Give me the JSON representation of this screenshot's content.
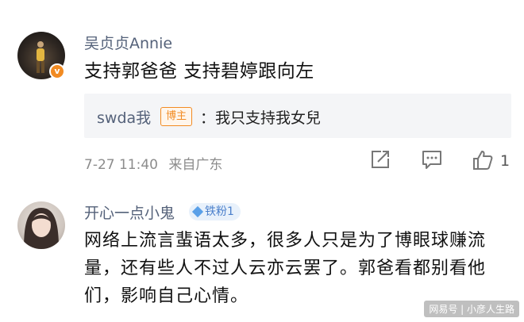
{
  "comments": [
    {
      "username": "吴贞贞Annie",
      "text": "支持郭爸爸 支持碧婷跟向左",
      "verified_badge": "v",
      "reply": {
        "username": "swda我",
        "tag": "博主",
        "text": "：我只支持我女兒"
      },
      "timestamp": "7-27 11:40",
      "location": "来自广东",
      "like_count": "1"
    },
    {
      "username": "开心一点小鬼",
      "fan_badge": "铁粉1",
      "text": "网络上流言蜚语太多，很多人只是为了博眼球赚流量，还有些人不过人云亦云罢了。郭爸看都别看他们，影响自己心情。"
    }
  ],
  "watermark": "网易号 | 小彦人生路",
  "icons": [
    "share-icon",
    "comment-icon",
    "like-icon",
    "diamond-icon"
  ],
  "colors": {
    "username": "#55627a",
    "accent": "#f28b22",
    "fan": "#4a7fcb"
  }
}
